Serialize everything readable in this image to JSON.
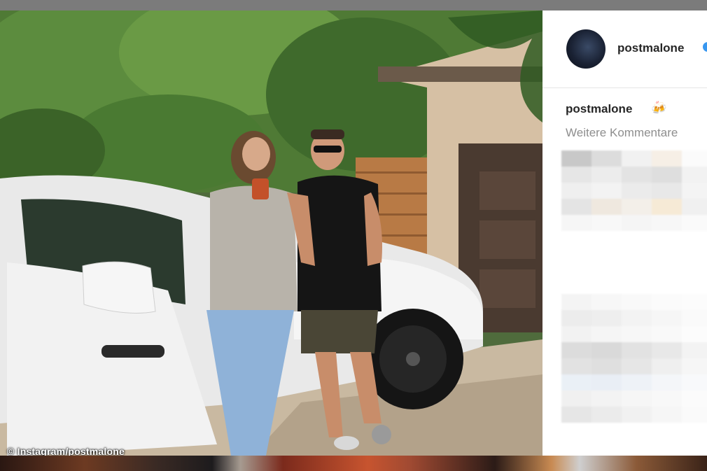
{
  "photo": {
    "credit": "© Instagram/postmalone"
  },
  "panel": {
    "header_username": "postmalone",
    "caption_username": "postmalone",
    "more_comments": "Weitere Kommentare",
    "icons": [
      "avatar",
      "verified-badge-icon",
      "beer-mugs-icon"
    ]
  },
  "colors": {
    "verified": "#3897f0",
    "text_primary": "#262626",
    "text_secondary": "#8e8e8e"
  }
}
